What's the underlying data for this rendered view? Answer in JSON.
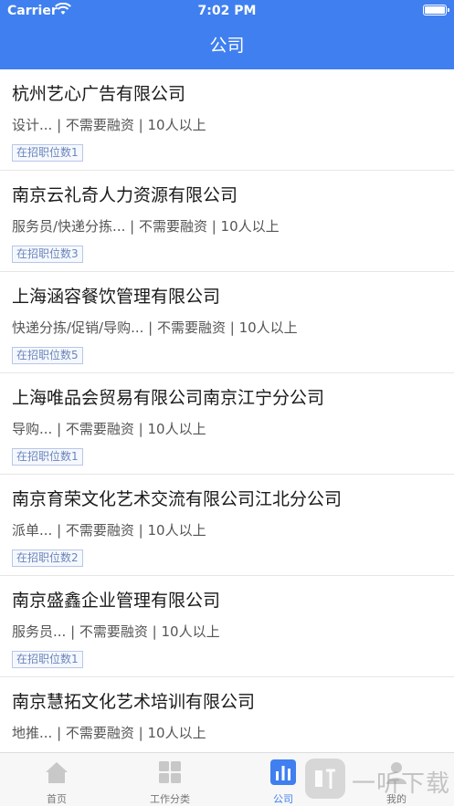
{
  "status": {
    "carrier": "Carrier",
    "time": "7:02 PM"
  },
  "header": {
    "title": "公司"
  },
  "companies": [
    {
      "name": "杭州艺心广告有限公司",
      "meta": "设计... | 不需要融资 | 10人以上",
      "badge": "在招职位数1"
    },
    {
      "name": "南京云礼奇人力资源有限公司",
      "meta": "服务员/快递分拣... | 不需要融资 | 10人以上",
      "badge": "在招职位数3"
    },
    {
      "name": "上海涵容餐饮管理有限公司",
      "meta": "快递分拣/促销/导购... | 不需要融资 | 10人以上",
      "badge": "在招职位数5"
    },
    {
      "name": "上海唯品会贸易有限公司南京江宁分公司",
      "meta": "导购... | 不需要融资 | 10人以上",
      "badge": "在招职位数1"
    },
    {
      "name": "南京育荣文化艺术交流有限公司江北分公司",
      "meta": "派单... | 不需要融资 | 10人以上",
      "badge": "在招职位数2"
    },
    {
      "name": "南京盛鑫企业管理有限公司",
      "meta": "服务员... | 不需要融资 | 10人以上",
      "badge": "在招职位数1"
    },
    {
      "name": "南京慧拓文化艺术培训有限公司",
      "meta": "地推... | 不需要融资 | 10人以上",
      "badge": ""
    }
  ],
  "tabbar": {
    "items": [
      {
        "label": "首页",
        "icon": "home-icon"
      },
      {
        "label": "工作分类",
        "icon": "grid-icon"
      },
      {
        "label": "公司",
        "icon": "bar-chart-icon",
        "active": true
      },
      {
        "label": "我的",
        "icon": "person-icon"
      }
    ]
  },
  "watermark": {
    "text": "一听下载",
    "icon": "listen-logo-icon"
  },
  "colors": {
    "brand": "#3f7ff0",
    "badge_text": "#6b86b8"
  }
}
